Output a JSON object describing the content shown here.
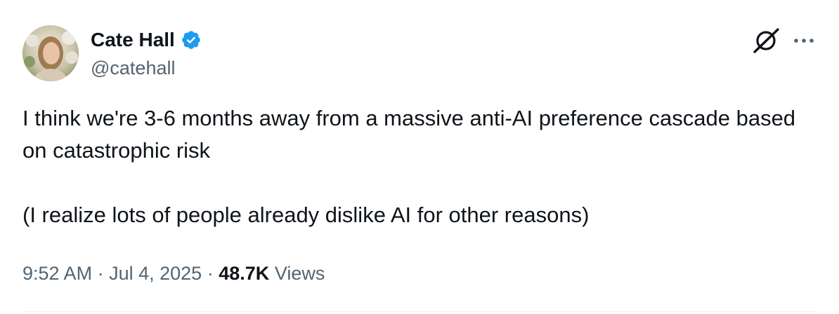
{
  "author": {
    "display_name": "Cate Hall",
    "handle": "@catehall",
    "verified": true
  },
  "tweet": {
    "paragraphs": [
      "I think we're 3-6 months away from a massive anti-AI preference cascade based on catastrophic risk",
      "(I realize lots of people already dislike AI for other reasons)"
    ]
  },
  "meta": {
    "time": "9:52 AM",
    "separator": "·",
    "date": "Jul 4, 2025",
    "views_count": "48.7K",
    "views_label": "Views"
  },
  "icons": {
    "verified": "verified-badge-icon",
    "grok": "grok-icon",
    "more": "more-options-icon"
  },
  "colors": {
    "verified": "#1d9bf0",
    "text": "#0f1419",
    "secondary": "#536471"
  }
}
